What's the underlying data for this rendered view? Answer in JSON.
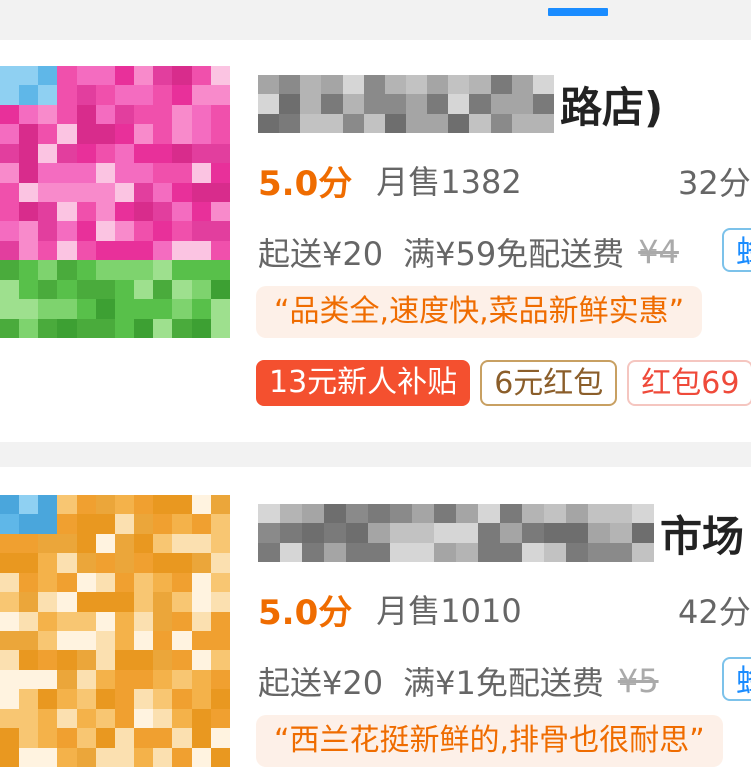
{
  "stores": [
    {
      "title_tail": "路店)",
      "rating": "5.0分",
      "monthly_sales": "月售1382",
      "delivery_time": "32分",
      "min_order": "起送¥20",
      "free_delivery": "满¥59免配送费",
      "original_fee": "¥4",
      "tag_partial": "蜂",
      "review_quote": "“品类全,速度快,菜品新鲜实惠”",
      "badges": [
        "13元新人补贴",
        "6元红包",
        "红包69"
      ]
    },
    {
      "title_tail": "市场",
      "rating": "5.0分",
      "monthly_sales": "月售1010",
      "delivery_time": "42分",
      "min_order": "起送¥20",
      "free_delivery": "满¥1免配送费",
      "original_fee": "¥5",
      "tag_partial": "蜂",
      "review_quote": "“西兰花挺新鲜的,排骨也很耐思”"
    }
  ],
  "colors": {
    "accent_orange": "#ef6c00",
    "tab_indicator": "#1a8cff",
    "subsidy_red": "#f4502f",
    "store1_image": "#e8309a",
    "store2_image": "#f0a030"
  },
  "icons": [
    "store-thumbnail-flowers",
    "store-thumbnail-produce"
  ]
}
